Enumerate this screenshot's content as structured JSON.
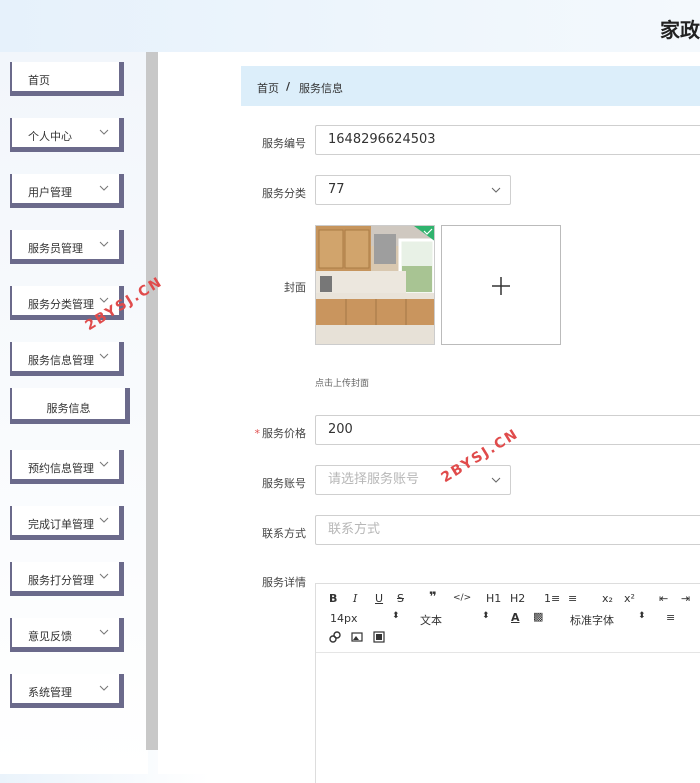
{
  "app": {
    "title": "家政"
  },
  "sidebar": {
    "items": [
      {
        "label": "首页",
        "expandable": false
      },
      {
        "label": "个人中心",
        "expandable": true
      },
      {
        "label": "用户管理",
        "expandable": true
      },
      {
        "label": "服务员管理",
        "expandable": true
      },
      {
        "label": "服务分类管理",
        "expandable": true
      },
      {
        "label": "服务信息管理",
        "expandable": true
      },
      {
        "label": "预约信息管理",
        "expandable": true
      },
      {
        "label": "完成订单管理",
        "expandable": true
      },
      {
        "label": "服务打分管理",
        "expandable": true
      },
      {
        "label": "意见反馈",
        "expandable": true
      },
      {
        "label": "系统管理",
        "expandable": true
      }
    ],
    "subitem": {
      "label": "服务信息"
    }
  },
  "breadcrumb": {
    "home": "首页",
    "separator": "/",
    "current": "服务信息"
  },
  "form": {
    "service_no": {
      "label": "服务编号",
      "value": "1648296624503"
    },
    "category": {
      "label": "服务分类",
      "value": "77"
    },
    "cover": {
      "label": "封面",
      "hint": "点击上传封面",
      "plus": "+"
    },
    "price": {
      "label": "服务价格",
      "required_mark": "*",
      "value": "200"
    },
    "account": {
      "label": "服务账号",
      "placeholder": "请选择服务账号"
    },
    "contact": {
      "label": "联系方式",
      "placeholder": "联系方式"
    },
    "details": {
      "label": "服务详情"
    }
  },
  "editor": {
    "row1": [
      "B",
      "I",
      "U",
      "S",
      "❞",
      "</>",
      "H1",
      "H2",
      "1≡",
      "≡",
      "x₂",
      "x²",
      "⇤",
      "⇥"
    ],
    "font_size": "14px",
    "text_type": "文本",
    "font_family": "标准字体",
    "row3_icons": [
      "link-icon",
      "image-icon",
      "video-icon"
    ]
  },
  "watermark": {
    "text": "2BYSJ.CN"
  },
  "colors": {
    "sidebar_border": "#6b6a8b",
    "breadcrumb_bg": "#dceefa",
    "required": "#e05050",
    "check": "#2fb36d"
  }
}
